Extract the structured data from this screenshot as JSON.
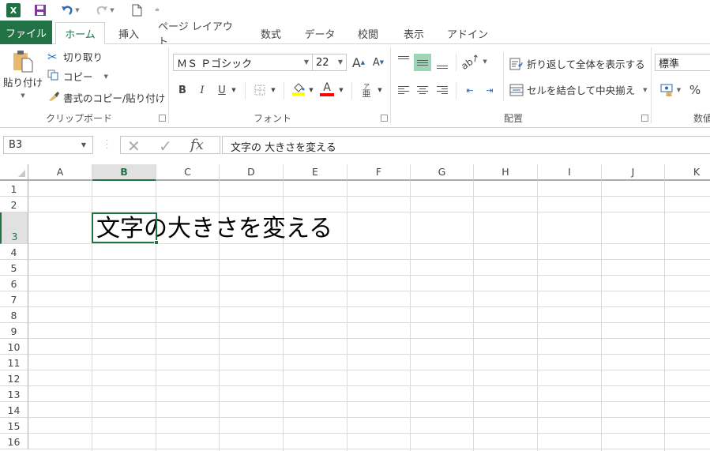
{
  "qat": {
    "app_icon": "excel-icon",
    "items": [
      "save-icon",
      "undo-icon",
      "redo-icon",
      "new-document-icon",
      "customize-qat-icon"
    ]
  },
  "tabs": [
    {
      "label": "ファイル",
      "active": false
    },
    {
      "label": "ホーム",
      "active": true
    },
    {
      "label": "挿入",
      "active": false
    },
    {
      "label": "ページ レイアウト",
      "active": false
    },
    {
      "label": "数式",
      "active": false
    },
    {
      "label": "データ",
      "active": false
    },
    {
      "label": "校閲",
      "active": false
    },
    {
      "label": "表示",
      "active": false
    },
    {
      "label": "アドイン",
      "active": false
    }
  ],
  "ribbon": {
    "clipboard": {
      "label": "クリップボード",
      "paste": "貼り付け",
      "cut": "切り取り",
      "copy": "コピー",
      "format_painter": "書式のコピー/貼り付け"
    },
    "font": {
      "label": "フォント",
      "font_name": "ＭＳ Ｐゴシック",
      "font_size": "22",
      "grow": "A",
      "shrink": "A",
      "bold": "B",
      "italic": "I",
      "underline": "U",
      "fill_color": "#ffff00",
      "font_color": "#ff0000",
      "phonetic": "亜"
    },
    "alignment": {
      "label": "配置",
      "wrap_text": "折り返して全体を表示する",
      "merge_center": "セルを結合して中央揃え"
    },
    "number": {
      "label": "数値",
      "format": "標準",
      "percent": "%"
    }
  },
  "formula_bar": {
    "name_box": "B3",
    "cancel": "✕",
    "enter": "✓",
    "fx": "fx",
    "value": "文字の 大きさを変える"
  },
  "sheet": {
    "columns": [
      "A",
      "B",
      "C",
      "D",
      "E",
      "F",
      "G",
      "H",
      "I",
      "J",
      "K"
    ],
    "rows": [
      "1",
      "2",
      "3",
      "4",
      "5",
      "6",
      "7",
      "8",
      "9",
      "10",
      "11",
      "12",
      "13",
      "14",
      "15",
      "16"
    ],
    "selected_column": "B",
    "selected_row": "3",
    "cells": {
      "B3": "文字の大きさを変える"
    }
  }
}
